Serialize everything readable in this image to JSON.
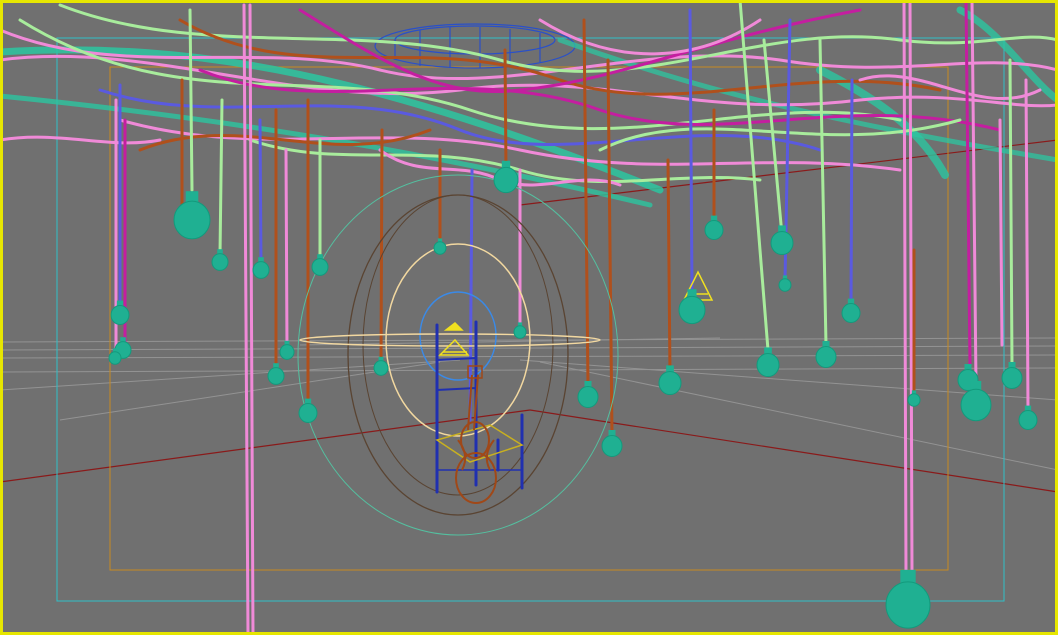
{
  "viewport": {
    "background": "#707070",
    "active_border": "#e6e600",
    "safe_frame_outer": "#2fc0c8",
    "safe_frame_inner": "#c88a20"
  },
  "colors": {
    "cable_pink": "#f08ad8",
    "cable_green": "#a8ec9c",
    "cable_teal": "#2cc6a0",
    "cable_blue": "#5a5ae0",
    "cable_brown": "#b0501c",
    "cable_magenta": "#c41ea0",
    "bulb": "#1fb092",
    "chair": "#2030b0",
    "guitar": "#a04818",
    "lamp_shade": "#f0e020",
    "gizmo_light": "#f2d8a0",
    "gizmo_blue": "#3a8ae8",
    "gizmo_dark": "#5a4432",
    "gizmo_teal": "#54c0a0",
    "grid": "#9a9a9a",
    "axis": "#8a1a1a"
  },
  "objects": [
    {
      "name": "hanging-bulbs",
      "icon": "bulb-icon"
    },
    {
      "name": "cable-lines",
      "icon": "cable-icon"
    },
    {
      "name": "chair",
      "icon": "chair-icon"
    },
    {
      "name": "guitar",
      "icon": "guitar-icon"
    },
    {
      "name": "light-gizmo",
      "icon": "light-icon"
    }
  ]
}
